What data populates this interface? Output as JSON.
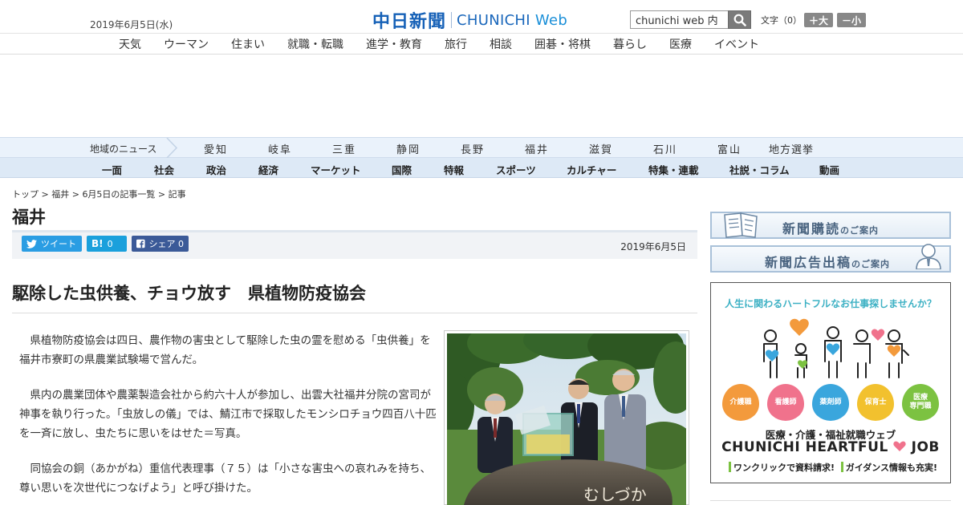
{
  "header": {
    "date": "2019年6月5日(水)",
    "logo_kanji": "中日新聞",
    "logo_en": "CHUNICHI",
    "logo_web": "Web",
    "search_value": "chunichi web 内",
    "fontsize_label": "文字（0）",
    "fontsize_up": "＋大",
    "fontsize_down": "－小"
  },
  "category_nav": [
    "天気",
    "ウーマン",
    "住まい",
    "就職・転職",
    "進学・教育",
    "旅行",
    "相談",
    "囲碁・将棋",
    "暮らし",
    "医療",
    "イベント"
  ],
  "region_nav": {
    "label": "地域のニュース",
    "items": [
      "愛知",
      "岐阜",
      "三重",
      "静岡",
      "長野",
      "福井",
      "滋賀",
      "石川",
      "富山",
      "地方選挙"
    ]
  },
  "section_nav": [
    "一面",
    "社会",
    "政治",
    "経済",
    "マーケット",
    "国際",
    "特報",
    "スポーツ",
    "カルチャー",
    "特集・連載",
    "社説・コラム",
    "動画"
  ],
  "breadcrumb": {
    "top": "トップ",
    "region": "福井",
    "list": "6月5日の記事一覧",
    "current": "記事",
    "sep": " > "
  },
  "page_title": "福井",
  "share": {
    "twitter": "ツイート",
    "hatena_icon": "B!",
    "hatena_count": "0",
    "facebook": "シェア",
    "facebook_count": "0",
    "date": "2019年6月5日"
  },
  "article": {
    "headline": "駆除した虫供養、チョウ放す　県植物防疫協会",
    "paragraphs": [
      "県植物防疫協会は四日、農作物の害虫として駆除した虫の霊を慰める「虫供養」を福井市寮町の県農業試験場で営んだ。",
      "県内の農業団体や農薬製造会社から約六十人が参加し、出雲大社福井分院の宮司が神事を執り行った。「虫放しの儀」では、鯖江市で採取したモンシロチョウ四百八十匹を一斉に放し、虫たちに思いをはせた＝写真。",
      "同協会の銅（あかがね）重信代表理事（７５）は「小さな害虫への哀れみを持ち、尊い思いを次世代につなげよう」と呼び掛けた。"
    ],
    "photo_stone_text": "むしづか"
  },
  "sidebar": {
    "subscribe_main": "新聞購読",
    "subscribe_sub": "のご案内",
    "ad_main": "新聞広告出稿",
    "ad_sub": "のご案内",
    "job_ad": {
      "headline": "人生に関わるハートフルなお仕事探しませんか？",
      "circles": [
        {
          "label": "介護職",
          "color": "#f39a3c"
        },
        {
          "label": "看護師",
          "color": "#f0728c"
        },
        {
          "label": "薬剤師",
          "color": "#3aa6dd"
        },
        {
          "label": "保育士",
          "color": "#f2c12e"
        },
        {
          "label": "医療\n専門職",
          "color": "#7cc241"
        }
      ],
      "sub": "医療・介護・福祉就職ウェブ",
      "brand_a": "CHUNICHI HEARTFUL",
      "brand_b": "JOB",
      "foot_a": "ワンクリックで資料請求!",
      "foot_b": "ガイダンス情報も充実!"
    }
  }
}
